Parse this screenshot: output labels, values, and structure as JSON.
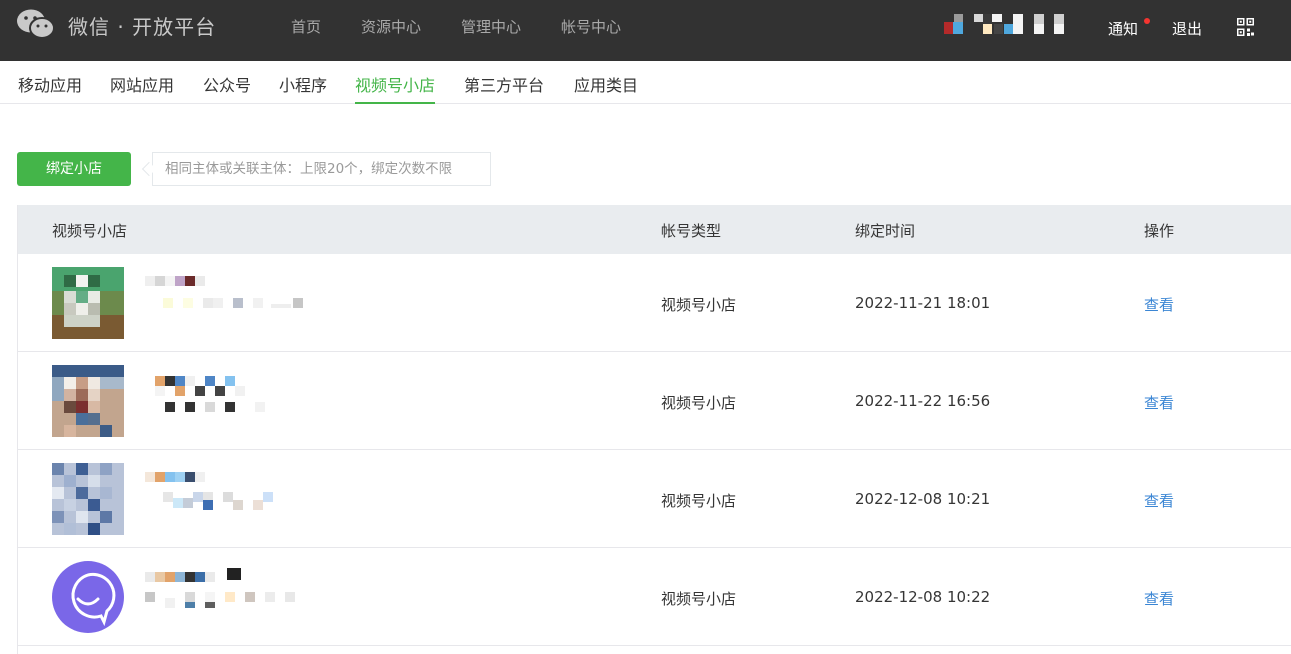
{
  "header": {
    "brand": "微信 · 开放平台",
    "nav": [
      "首页",
      "资源中心",
      "管理中心",
      "帐号中心"
    ],
    "notify": "通知",
    "logout": "退出"
  },
  "tabs": [
    "移动应用",
    "网站应用",
    "公众号",
    "小程序",
    "视频号小店",
    "第三方平台",
    "应用类目"
  ],
  "active_tab": "视频号小店",
  "bind": {
    "button": "绑定小店",
    "hint": "相同主体或关联主体：上限20个，绑定次数不限"
  },
  "table": {
    "columns": [
      "视频号小店",
      "帐号类型",
      "绑定时间",
      "操作"
    ],
    "rows": [
      {
        "type": "视频号小店",
        "time": "2022-11-21 18:01",
        "action": "查看"
      },
      {
        "type": "视频号小店",
        "time": "2022-11-22 16:56",
        "action": "查看"
      },
      {
        "type": "视频号小店",
        "time": "2022-12-08 10:21",
        "action": "查看"
      },
      {
        "type": "视频号小店",
        "time": "2022-12-08 10:22",
        "action": "查看"
      }
    ]
  },
  "colors": {
    "accent": "#44b549",
    "link": "#3b86d4",
    "topbar": "#323232",
    "notify_dot": "#f43530"
  }
}
